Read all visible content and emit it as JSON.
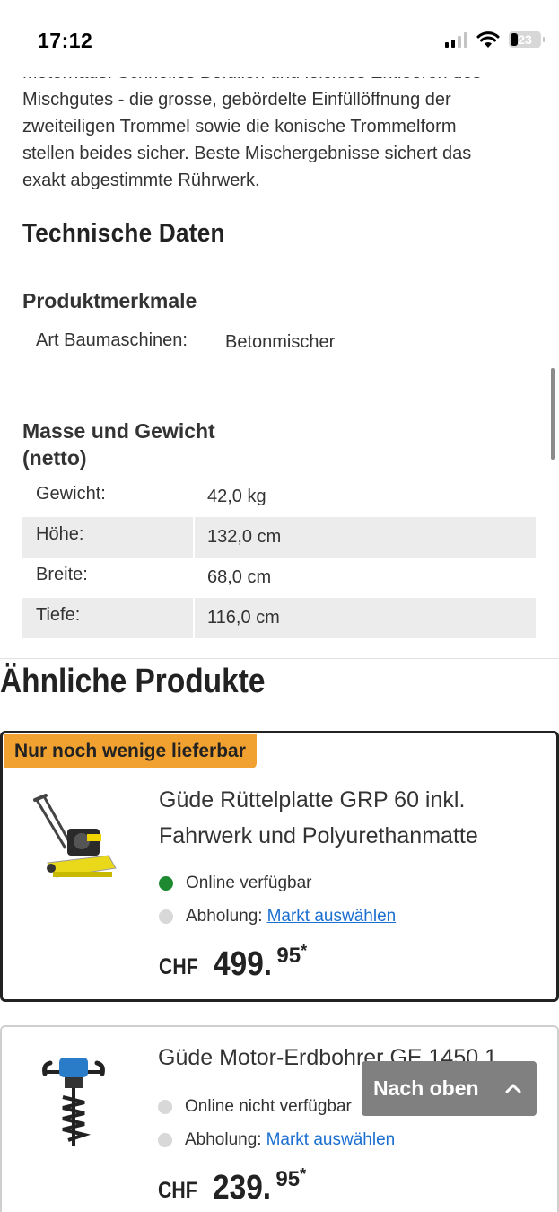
{
  "status_bar": {
    "time": "17:12",
    "battery": "23"
  },
  "description": {
    "clipped_line": "Motorhaus. Schnelles Befüllen und leichtes Entleeren des",
    "lines": [
      "Mischgutes - die grosse, gebördelte Einfüllöffnung der",
      "zweiteiligen Trommel sowie die konische Trommelform",
      "stellen beides sicher. Beste Mischergebnisse sichert das",
      "exakt abgestimmte Rührwerk."
    ]
  },
  "tech": {
    "heading": "Technische Daten",
    "features_heading": "Produktmerkmale",
    "art_label": "Art Baumaschinen:",
    "art_value": "Betonmischer",
    "mass_heading": "Masse und Gewicht (netto)",
    "rows": [
      {
        "label": "Gewicht:",
        "value": "42,0 kg"
      },
      {
        "label": "Höhe:",
        "value": "132,0 cm"
      },
      {
        "label": "Breite:",
        "value": "68,0 cm"
      },
      {
        "label": "Tiefe:",
        "value": "116,0 cm"
      }
    ]
  },
  "similar": {
    "heading": "Ähnliche Produkte",
    "products": [
      {
        "badge": "Nur noch wenige lieferbar",
        "title": "Güde Rüttelplatte GRP 60 inkl. Fahrwerk und Polyurethanmatte",
        "image_icon": "plate-compactor-icon",
        "online": "Online verfügbar",
        "online_color": "#1d8a32",
        "pickup_label": "Abholung:",
        "pickup_link": "Markt auswählen",
        "currency": "CHF",
        "price_main": "499.",
        "price_dec": "95",
        "price_star": "*"
      },
      {
        "title": "Güde Motor-Erdbohrer GE 1450.1",
        "image_icon": "earth-auger-icon",
        "online": "Online nicht verfügbar",
        "online_color": "#d8d8d8",
        "pickup_label": "Abholung:",
        "pickup_link": "Markt auswählen",
        "currency": "CHF",
        "price_main": "239.",
        "price_dec": "95",
        "price_star": "*"
      }
    ]
  },
  "back_to_top": {
    "label": "Nach oben"
  },
  "colors": {
    "badge": "#f0a12f",
    "link": "#1b6fd1",
    "available": "#1d8a32"
  }
}
